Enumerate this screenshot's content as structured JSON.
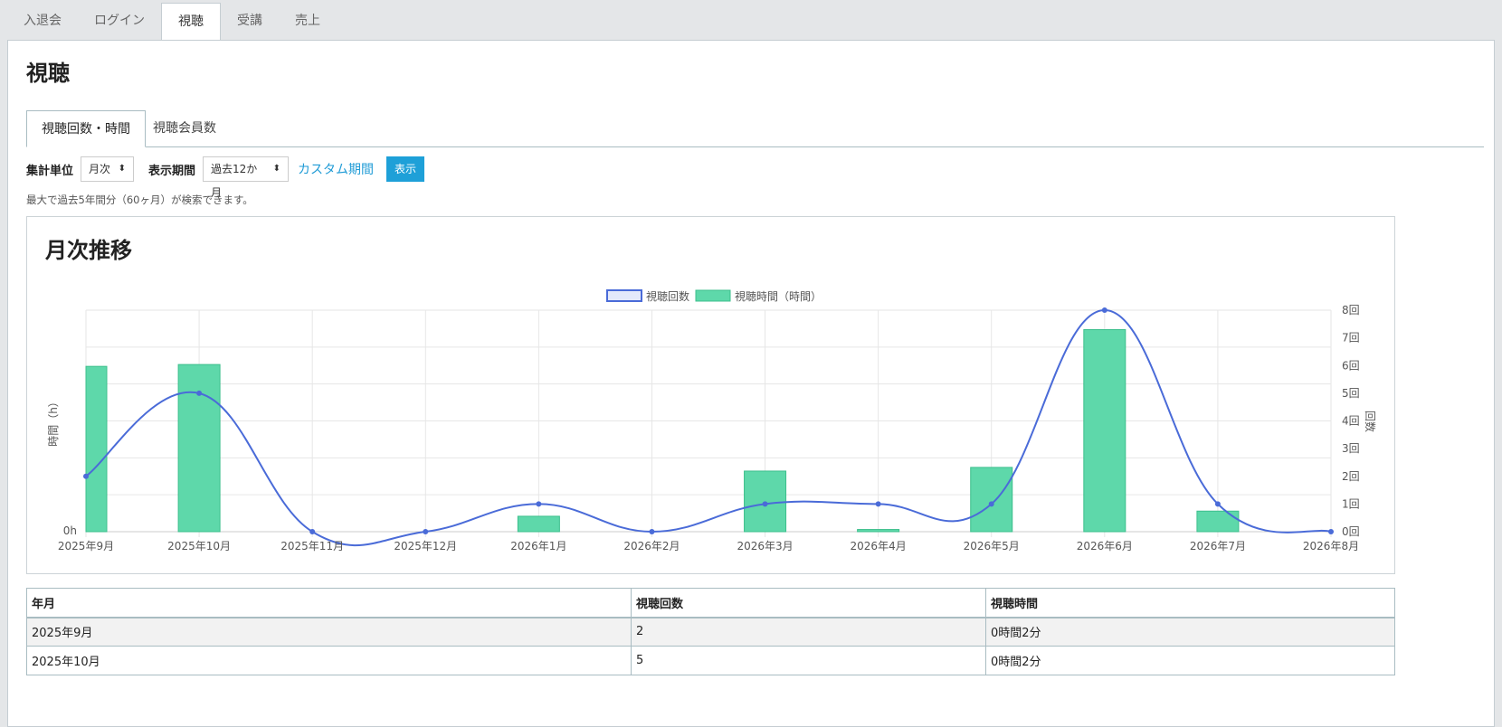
{
  "nav": {
    "tabs": [
      {
        "label": "入退会"
      },
      {
        "label": "ログイン"
      },
      {
        "label": "視聴"
      },
      {
        "label": "受講"
      },
      {
        "label": "売上"
      }
    ],
    "active_index": 2
  },
  "page": {
    "title": "視聴",
    "subtabs": [
      {
        "label": "視聴回数・時間"
      },
      {
        "label": "視聴会員数"
      }
    ],
    "active_subtab": 0
  },
  "controls": {
    "unit_label": "集計単位",
    "unit_value": "月次",
    "period_label": "表示期間",
    "period_value": "過去12か月",
    "custom_link": "カスタム期間",
    "show_button": "表示",
    "note": "最大で過去5年間分（60ヶ月）が検索できます。"
  },
  "chart_section": {
    "title": "月次推移"
  },
  "colors": {
    "line": "#4a6bd8",
    "bar": "#5ed8aa",
    "bar_border": "#3cbf8c",
    "accent": "#1ea0d8",
    "link": "#1f9bd6"
  },
  "chart_data": {
    "type": "bar",
    "categories": [
      "2025年9月",
      "2025年10月",
      "2025年11月",
      "2025年12月",
      "2026年1月",
      "2026年2月",
      "2026年3月",
      "2026年4月",
      "2026年5月",
      "2026年6月",
      "2026年7月",
      "2026年8月"
    ],
    "series": [
      {
        "name": "視聴回数",
        "type": "line",
        "axis": "right",
        "values": [
          2,
          5,
          0,
          0,
          1,
          0,
          1,
          1,
          1,
          8,
          1,
          0
        ]
      },
      {
        "name": "視聴時間（時間）",
        "type": "bar",
        "axis": "left",
        "values": [
          0.045,
          0.0455,
          0,
          0,
          0.0042,
          0,
          0.0165,
          0.0006,
          0.0175,
          0.055,
          0.0056,
          0
        ]
      }
    ],
    "ylabel_left": "時間（h）",
    "ylabel_right": "回数",
    "y_left_ticks": [
      "0h"
    ],
    "y_right_ticks": [
      "0回",
      "1回",
      "2回",
      "3回",
      "4回",
      "5回",
      "6回",
      "7回",
      "8回"
    ],
    "ylim_right": [
      0,
      8
    ],
    "legend_position": "top",
    "grid": true
  },
  "table": {
    "headers": [
      "年月",
      "視聴回数",
      "視聴時間"
    ],
    "rows": [
      [
        "2025年9月",
        "2",
        "0時間2分"
      ],
      [
        "2025年10月",
        "5",
        "0時間2分"
      ]
    ]
  }
}
